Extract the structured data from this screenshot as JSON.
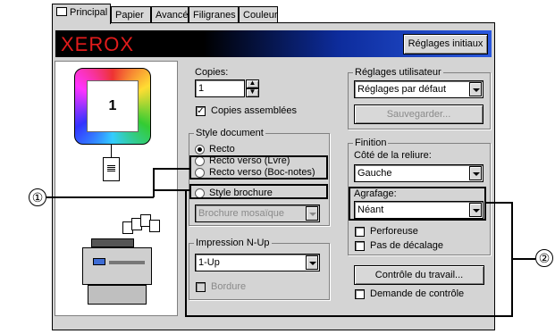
{
  "tabs": [
    {
      "label": "Principal",
      "icon": "printer-icon",
      "active": true
    },
    {
      "label": "Papier"
    },
    {
      "label": "Avancé"
    },
    {
      "label": "Filigranes"
    },
    {
      "label": "Couleur"
    }
  ],
  "banner": {
    "brand": "XEROX",
    "reset_button": "Réglages initiaux"
  },
  "preview": {
    "page_number": "1"
  },
  "copies": {
    "label": "Copies:",
    "value": "1",
    "collate_label": "Copies assemblées",
    "collate_checked": true
  },
  "style_document": {
    "title": "Style document",
    "options": [
      "Recto",
      "Recto verso (Lvre)",
      "Recto verso (Boc-notes)",
      "Style brochure"
    ],
    "selected": "Recto",
    "brochure_select": "Brochure mosaïque"
  },
  "nup": {
    "title": "Impression N-Up",
    "value": "1-Up",
    "border_label": "Bordure"
  },
  "user_settings": {
    "title": "Réglages utilisateur",
    "value": "Réglages par défaut",
    "save_button": "Sauvegarder..."
  },
  "finition": {
    "title": "Finition",
    "binding_label": "Côté de la reliure:",
    "binding_value": "Gauche",
    "staple_label": "Agrafage:",
    "staple_value": "Néant",
    "perforation_label": "Perforeuse",
    "no_offset_label": "Pas de décalage"
  },
  "job_control_button": "Contrôle du travail...",
  "request_control_label": "Demande de contrôle",
  "callouts": {
    "one": "①",
    "two": "②"
  }
}
